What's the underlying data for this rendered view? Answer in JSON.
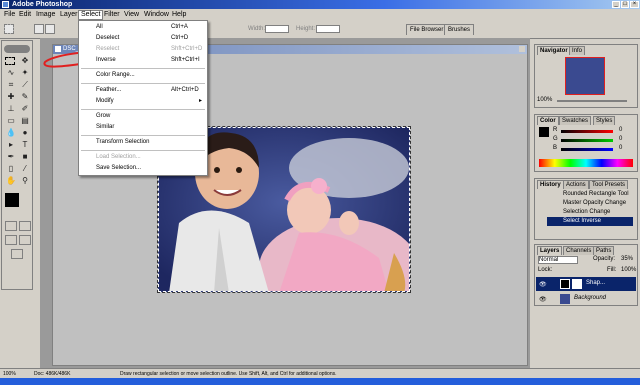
{
  "titlebar": {
    "title": "Adobe Photoshop"
  },
  "menubar": [
    "File",
    "Edit",
    "Image",
    "Layer",
    "Select",
    "Filter",
    "View",
    "Window",
    "Help"
  ],
  "options_bar": {
    "width_label": "Width:",
    "height_label": "Height:",
    "tab_file_browser": "File Browser",
    "tab_brushes": "Brushes"
  },
  "select_menu": {
    "items": [
      {
        "label": "All",
        "shortcut": "Ctrl+A",
        "disabled": false
      },
      {
        "label": "Deselect",
        "shortcut": "Ctrl+D",
        "disabled": false
      },
      {
        "label": "Reselect",
        "shortcut": "Shft+Ctrl+D",
        "disabled": true
      },
      {
        "label": "Inverse",
        "shortcut": "Shft+Ctrl+I",
        "disabled": false
      },
      {
        "label": "Color Range...",
        "shortcut": "",
        "disabled": false
      },
      {
        "label": "Feather...",
        "shortcut": "Alt+Ctrl+D",
        "disabled": false
      },
      {
        "label": "Modify",
        "shortcut": "▸",
        "disabled": false
      },
      {
        "label": "Grow",
        "shortcut": "",
        "disabled": false
      },
      {
        "label": "Similar",
        "shortcut": "",
        "disabled": false
      },
      {
        "label": "Transform Selection",
        "shortcut": "",
        "disabled": false
      },
      {
        "label": "Load Selection...",
        "shortcut": "",
        "disabled": true
      },
      {
        "label": "Save Selection...",
        "shortcut": "",
        "disabled": false
      }
    ]
  },
  "document": {
    "title": "DSC_050"
  },
  "navigator": {
    "tab_navigator": "Navigator",
    "tab_info": "Info",
    "zoom": "100%"
  },
  "color_panel": {
    "tab_color": "Color",
    "tab_swatches": "Swatches",
    "tab_styles": "Styles",
    "r_label": "R",
    "g_label": "G",
    "b_label": "B",
    "r": "0",
    "g": "0",
    "b": "0"
  },
  "history_panel": {
    "tab_history": "History",
    "tab_actions": "Actions",
    "tab_tool_presets": "Tool Presets",
    "items": [
      "Rounded Rectangle Tool",
      "Master Opacity Change",
      "Selection Change",
      "Select Inverse"
    ]
  },
  "layers_panel": {
    "tab_layers": "Layers",
    "tab_channels": "Channels",
    "tab_paths": "Paths",
    "blend_mode": "Normal",
    "opacity_label": "Opacity:",
    "opacity": "35%",
    "lock_label": "Lock:",
    "fill_label": "Fill:",
    "fill": "100%",
    "layers": [
      {
        "name": "Shap..."
      },
      {
        "name": "Background"
      }
    ]
  },
  "statusbar": {
    "zoom": "100%",
    "doc_size": "Doc: 486K/486K",
    "hint": "Draw rectangular selection or move selection outline. Use Shift, Alt, and Ctrl for additional options."
  },
  "colors": {
    "accent": "#0a246a",
    "history_selected": "#0a246a",
    "annotation": "#e02020"
  }
}
